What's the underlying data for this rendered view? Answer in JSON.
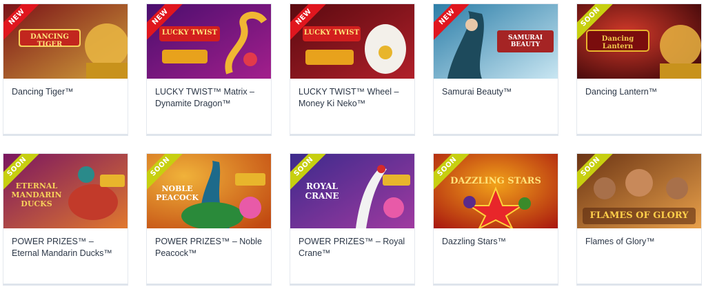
{
  "games": [
    {
      "title": "Dancing Tiger™",
      "badge": "NEW",
      "logo": "DANCING TIGER",
      "bg1": "#7a1218",
      "bg2": "#d2a13b"
    },
    {
      "title": "LUCKY TWIST™ Matrix – Dynamite Dragon™",
      "badge": "NEW",
      "logo": "LUCKY TWIST",
      "bg1": "#4a0e6e",
      "bg2": "#a31f8c"
    },
    {
      "title": "LUCKY TWIST™ Wheel – Money Ki Neko™",
      "badge": "NEW",
      "logo": "LUCKY TWIST",
      "bg1": "#5a0a10",
      "bg2": "#b1202a"
    },
    {
      "title": "Samurai Beauty™",
      "badge": "NEW",
      "logo": "SAMURAI BEAUTY",
      "bg1": "#2c7ea8",
      "bg2": "#c9e6f2"
    },
    {
      "title": "Dancing Lantern™",
      "badge": "SOON",
      "logo": "Dancing Lantern",
      "bg1": "#6b0b10",
      "bg2": "#d23a2a"
    },
    {
      "title": "POWER PRIZES™ – Eternal Mandarin Ducks™",
      "badge": "SOON",
      "logo": "ETERNAL MANDARIN DUCKS",
      "bg1": "#7a1660",
      "bg2": "#e0782e"
    },
    {
      "title": "POWER PRIZES™ – Noble Peacock™",
      "badge": "SOON",
      "logo": "NOBLE PEACOCK",
      "bg1": "#c24a12",
      "bg2": "#f0b23a"
    },
    {
      "title": "POWER PRIZES™ – Royal Crane™",
      "badge": "SOON",
      "logo": "ROYAL CRANE",
      "bg1": "#3c2a8c",
      "bg2": "#a03aa0"
    },
    {
      "title": "Dazzling Stars™",
      "badge": "SOON",
      "logo": "DAZZLING STARS",
      "bg1": "#a6120e",
      "bg2": "#f2a21a"
    },
    {
      "title": "Flames of Glory™",
      "badge": "SOON",
      "logo": "FLAMES OF GLORY",
      "bg1": "#6b3414",
      "bg2": "#e8a04a"
    }
  ]
}
